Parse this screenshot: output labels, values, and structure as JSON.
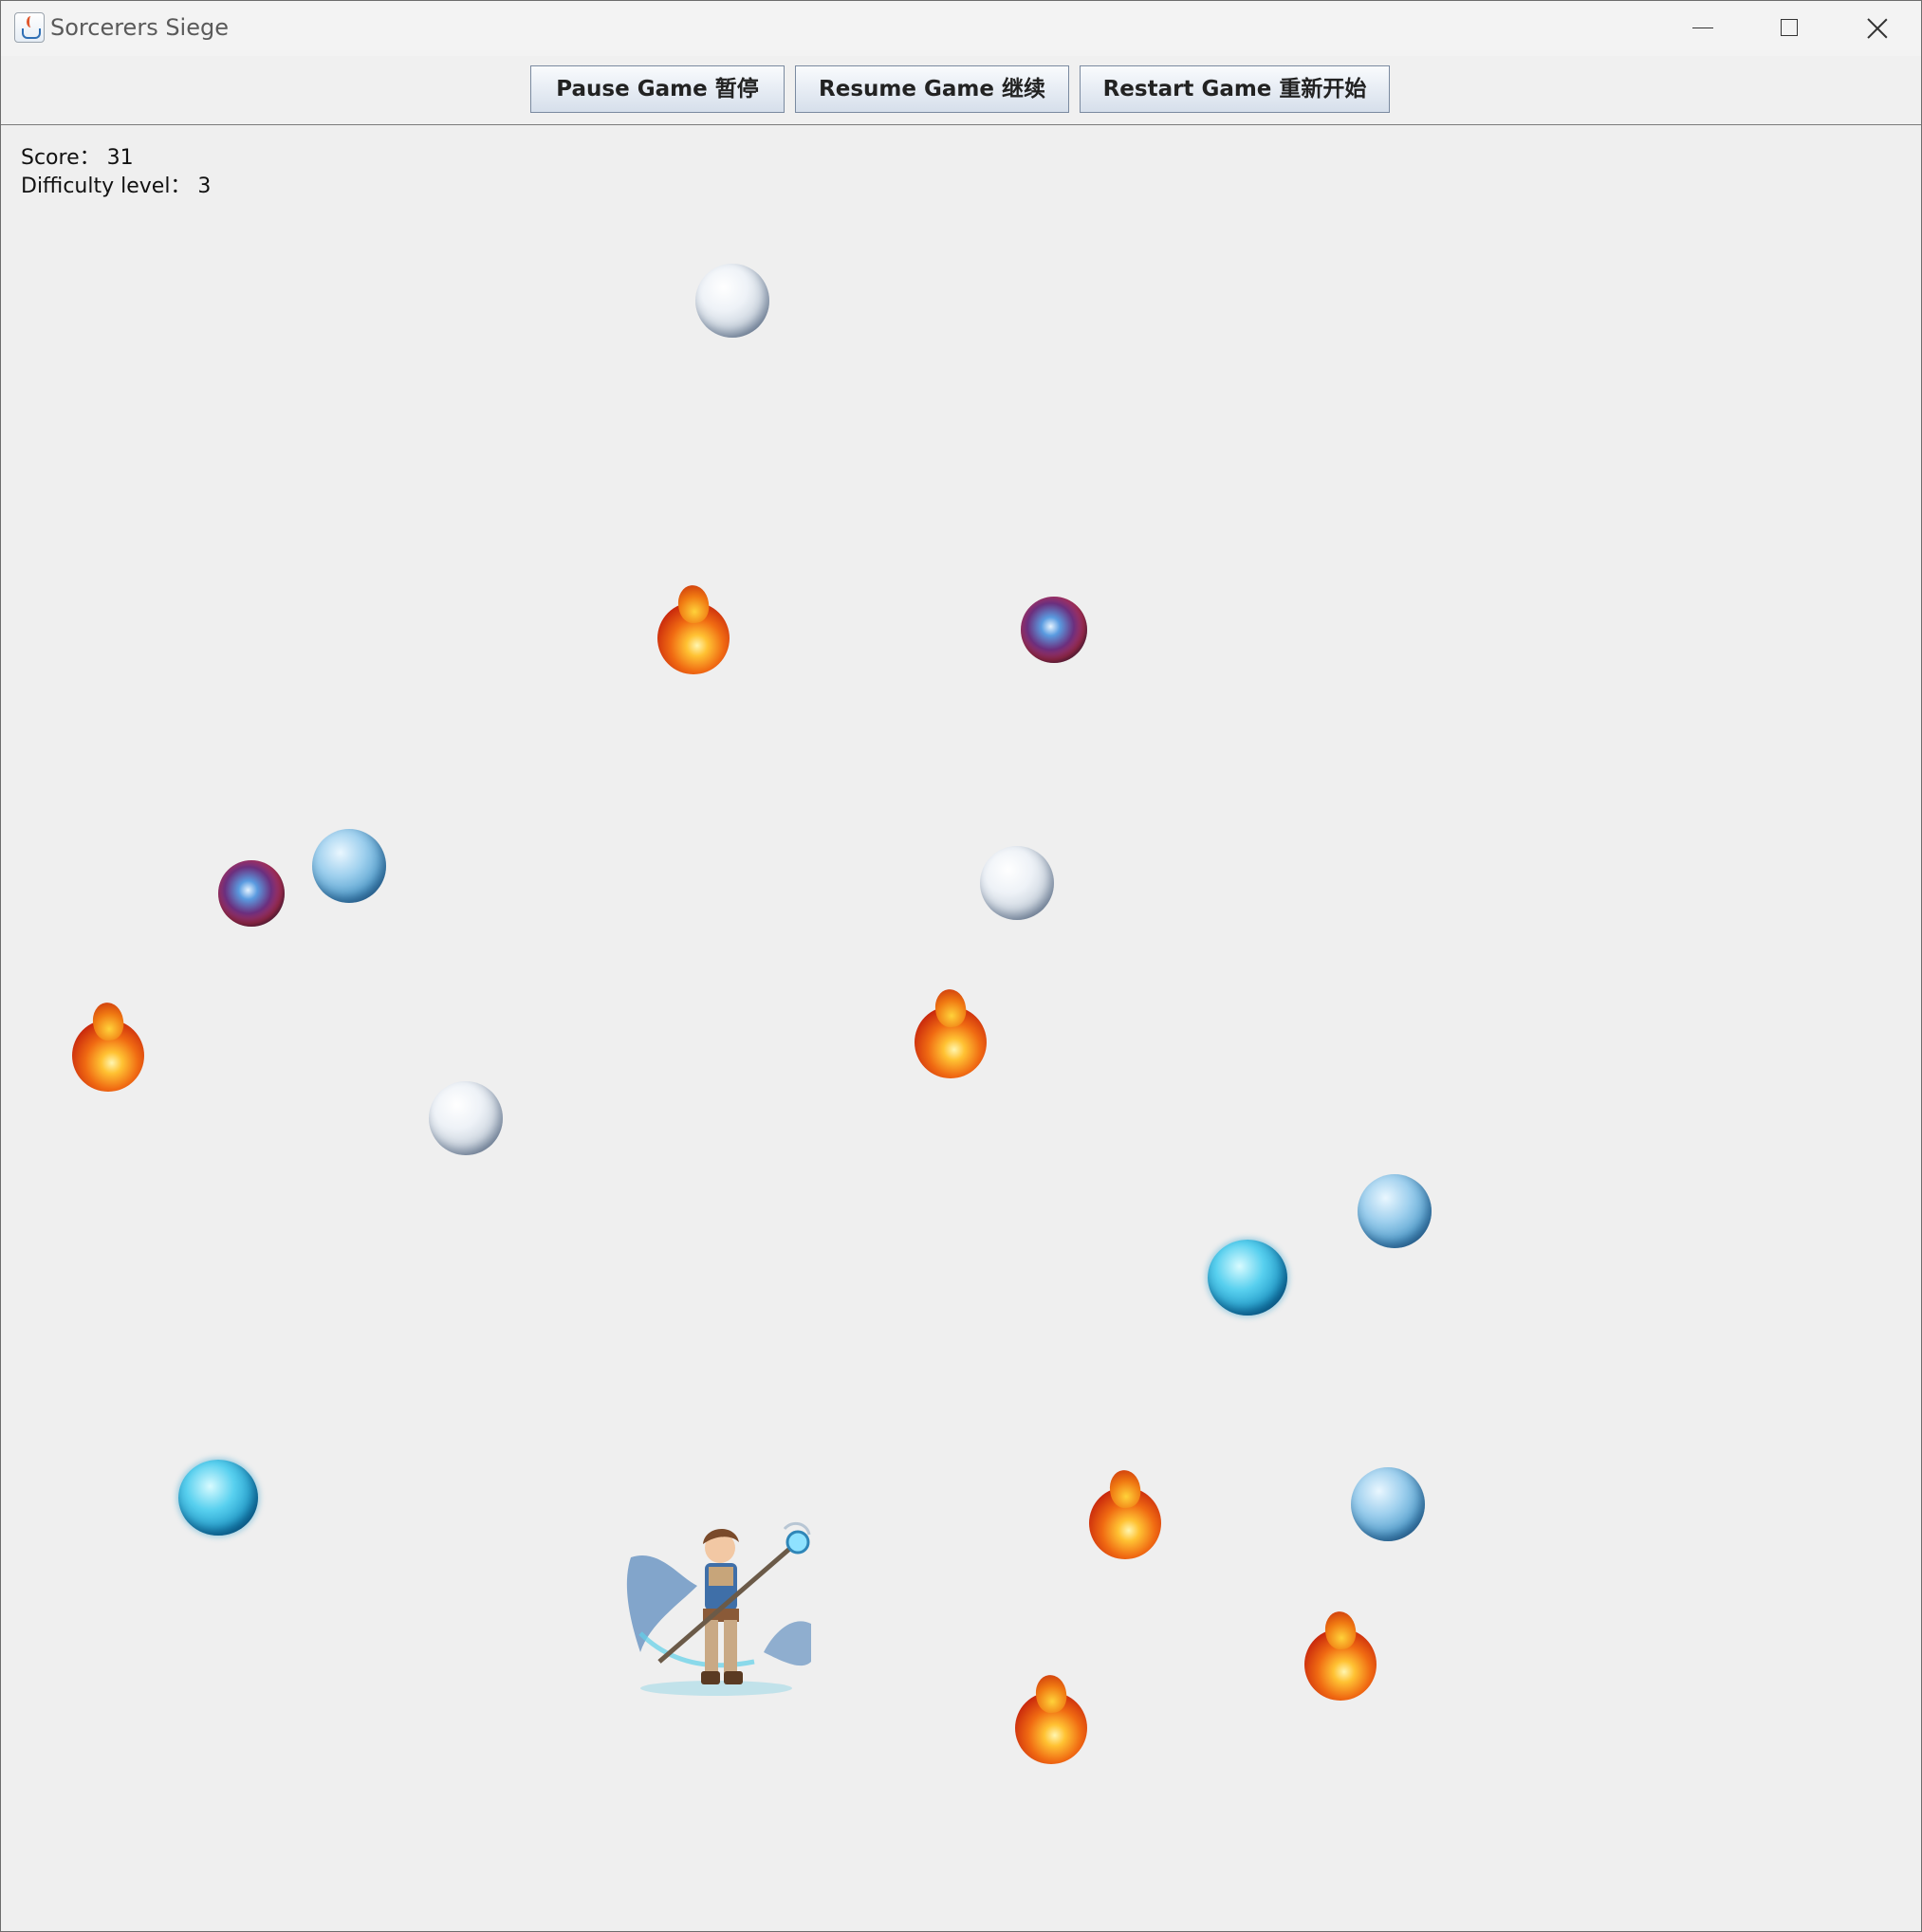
{
  "window": {
    "title": "Sorcerers Siege",
    "app_icon": "java-cup-icon",
    "controls": [
      "minimize-icon",
      "maximize-icon",
      "close-icon"
    ]
  },
  "toolbar": {
    "pause_label": "Pause Game 暂停",
    "resume_label": "Resume Game 继续",
    "restart_label": "Restart Game 重新开始"
  },
  "hud": {
    "score_text": "Score：  31",
    "difficulty_text": "Difficulty level：  3"
  },
  "game": {
    "player": "sorcerer-with-staff",
    "projectile_types": [
      "snowball",
      "fireball",
      "arcane-orb",
      "ice-orb",
      "water-orb"
    ],
    "colors": {
      "background": "#efefef",
      "button_face": "#e4eaf2"
    }
  }
}
